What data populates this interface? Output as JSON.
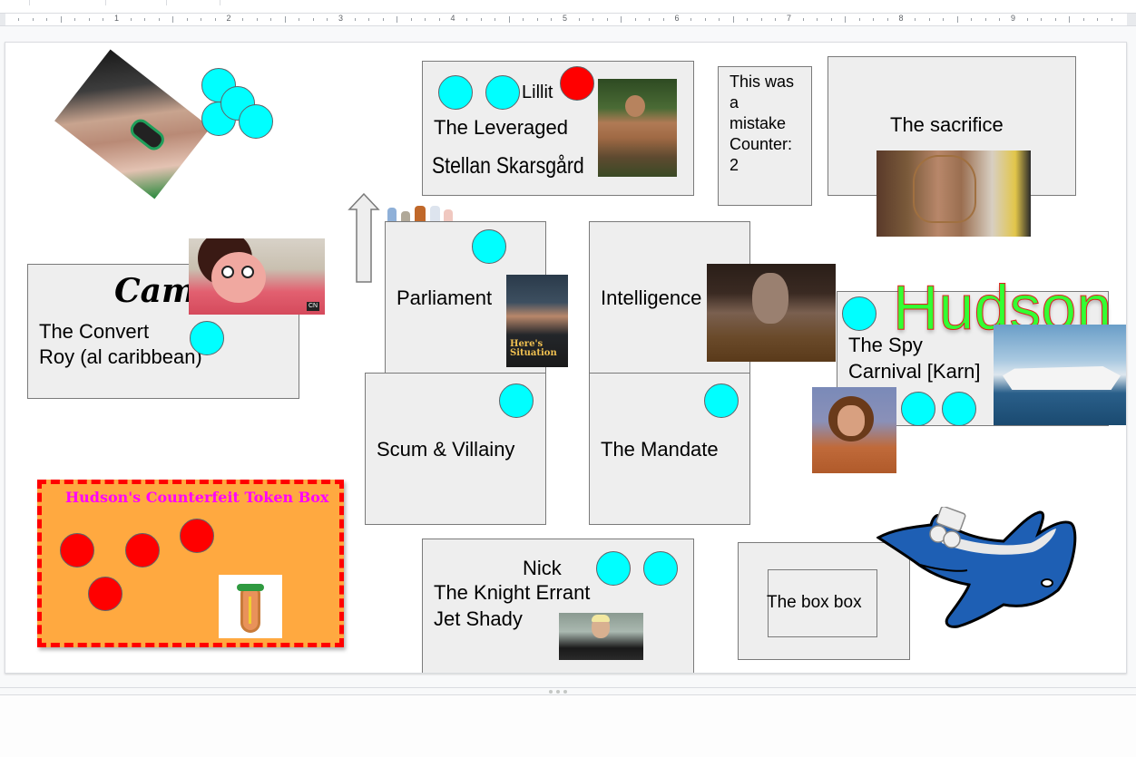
{
  "ruler": {
    "numbers": [
      "1",
      "2",
      "3",
      "4",
      "5",
      "6",
      "7",
      "8",
      "9"
    ]
  },
  "colors": {
    "token_cyan": "#00ffff",
    "token_red": "#ff0000",
    "box_fill": "#eeeeee",
    "counterfeit_box_fill": "#ffa940",
    "counterfeit_border": "#ff0000",
    "counterfeit_title": "#ff00ff",
    "hudson_text": "#00ff00",
    "plane_blue": "#1e5fb4"
  },
  "slide": {
    "top_left_image": {
      "icon": "smoking-person-photo"
    },
    "leveraged_box": {
      "player": "Lillit",
      "faction": "The Leveraged",
      "character": "Stellan Skarsgård",
      "image": "tarzan-photo"
    },
    "mistake_box": {
      "lines": [
        "This was",
        "a",
        "mistake",
        "Counter:",
        "2"
      ]
    },
    "sacrifice_box": {
      "label": "The sacrifice",
      "image": "bee-cage-photo"
    },
    "convert_box": {
      "player": "Cam",
      "faction": "The Convert",
      "character": "Roy (al caribbean)",
      "image": "steven-universe-image"
    },
    "arrow": {
      "icon": "up-arrow-icon"
    },
    "group_image": "group-of-people-photo",
    "parliament_box": {
      "label": "Parliament",
      "image": "heres-the-situation-book-cover"
    },
    "intelligence_box": {
      "label": "Intelligence",
      "image": "garak-photo"
    },
    "spy_box": {
      "big_label": "Hudson",
      "faction": "The Spy",
      "character": "Carnival [Karn]",
      "images": [
        "cruise-ship-photo",
        "doug-henning-photo"
      ]
    },
    "scum_box": {
      "label": "Scum & Villainy"
    },
    "mandate_box": {
      "label": "The Mandate"
    },
    "counterfeit_box": {
      "title": "Hudson's Counterfeit Token Box",
      "image": "dancing-hotdog-image",
      "red_token_count": 4
    },
    "nick_box": {
      "player": "Nick",
      "faction": "The Knight Errant",
      "character": "Jet Shady",
      "image": "eminem-photo"
    },
    "box_box": {
      "label": "The box box"
    },
    "plane_image": "blue-cartoon-airplane"
  }
}
